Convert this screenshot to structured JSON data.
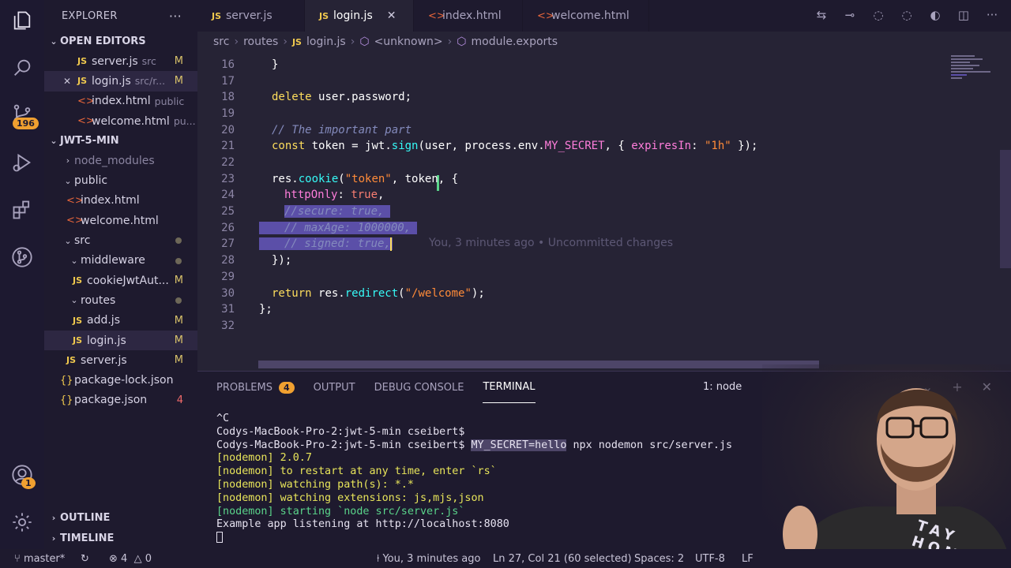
{
  "activity": {
    "source_control_badge": "196",
    "account_badge": "1"
  },
  "sidebar": {
    "title": "EXPLORER",
    "more": "···",
    "open_editors_title": "OPEN EDITORS",
    "open_editors": [
      {
        "icon": "JS",
        "name": "server.js",
        "desc": "src",
        "mark": "M"
      },
      {
        "icon": "JS",
        "name": "login.js",
        "desc": "src/r...",
        "mark": "M",
        "close": "✕"
      },
      {
        "icon": "<>",
        "name": "index.html",
        "desc": "public",
        "mark": ""
      },
      {
        "icon": "<>",
        "name": "welcome.html",
        "desc": "pu...",
        "mark": ""
      }
    ],
    "project_title": "JWT-5-MIN",
    "tree": [
      {
        "name": "node_modules",
        "type": "folder"
      },
      {
        "name": "public",
        "type": "folder"
      },
      {
        "name": "index.html",
        "type": "html"
      },
      {
        "name": "welcome.html",
        "type": "html"
      },
      {
        "name": "src",
        "type": "folder"
      },
      {
        "name": "middleware",
        "type": "folder"
      },
      {
        "name": "cookieJwtAut...",
        "type": "js",
        "mark": "M"
      },
      {
        "name": "routes",
        "type": "folder"
      },
      {
        "name": "add.js",
        "type": "js",
        "mark": "M"
      },
      {
        "name": "login.js",
        "type": "js",
        "mark": "M"
      },
      {
        "name": "server.js",
        "type": "js",
        "mark": "M"
      },
      {
        "name": "package-lock.json",
        "type": "json"
      },
      {
        "name": "package.json",
        "type": "json",
        "mark": "4"
      }
    ],
    "outline": "OUTLINE",
    "timeline": "TIMELINE"
  },
  "tabs": [
    {
      "icon": "JS",
      "label": "server.js"
    },
    {
      "icon": "JS",
      "label": "login.js",
      "close": "✕"
    },
    {
      "icon": "<>",
      "label": "index.html"
    },
    {
      "icon": "<>",
      "label": "welcome.html"
    }
  ],
  "breadcrumb": {
    "parts": [
      "src",
      "routes",
      "login.js",
      "<unknown>",
      "module.exports"
    ],
    "js_icon": "JS"
  },
  "editor": {
    "line_numbers": [
      "16",
      "17",
      "18",
      "19",
      "20",
      "21",
      "22",
      "23",
      "24",
      "25",
      "26",
      "27",
      "28",
      "29",
      "30",
      "31",
      "32"
    ],
    "lines": {
      "l16": "}",
      "l18_kw": "delete",
      "l18_rest": "user.password;",
      "l20": "// The important part",
      "l21_kw": "const",
      "l21_a": "token =",
      "l21_b": "jwt.",
      "l21_fn": "sign",
      "l21_c": "(user, process.env.",
      "l21_d": "MY_SECRET",
      "l21_e": ", {",
      "l21_f": "expiresIn",
      "l21_g": ":",
      "l21_str": "\"1h\"",
      "l21_h": "});",
      "l23_a": "res.",
      "l23_fn": "cookie",
      "l23_b": "(",
      "l23_str": "\"token\"",
      "l23_c": ", token, {",
      "l24_prop": "httpOnly",
      "l24_b": ":",
      "l24_bool": "true",
      "l24_c": ",",
      "l25": "//secure: true,",
      "l26": "// maxAge: 1000000,",
      "l27": "// signed: true,",
      "l27_blame": "You, 3 minutes ago • Uncommitted changes",
      "l28": "});",
      "l30_kw": "return",
      "l30_a": "res.",
      "l30_fn": "redirect",
      "l30_b": "(",
      "l30_str": "\"/welcome\"",
      "l30_c": ");",
      "l31": "};"
    }
  },
  "panel": {
    "problems": "PROBLEMS",
    "problems_count": "4",
    "output": "OUTPUT",
    "debug": "DEBUG CONSOLE",
    "terminal": "TERMINAL",
    "terminal_select": "1: node",
    "terminal_lines": {
      "t1": "^C",
      "t2": "Codys-MacBook-Pro-2:jwt-5-min cseibert$",
      "t3_prompt": "Codys-MacBook-Pro-2:jwt-5-min cseibert$ ",
      "t3_sel": "MY_SECRET=hello",
      "t3_rest": " npx nodemon src/server.js",
      "t4": "[nodemon] 2.0.7",
      "t5": "[nodemon] to restart at any time, enter `rs`",
      "t6": "[nodemon] watching path(s): *.*",
      "t7": "[nodemon] watching extensions: js,mjs,json",
      "t8": "[nodemon] starting `node src/server.js`",
      "t9": "Example app listening at http://localhost:8080"
    }
  },
  "statusbar": {
    "branch": "master*",
    "errors": "⊗ 4",
    "warnings": "△ 0",
    "blame": "You, 3 minutes ago",
    "position": "Ln 27, Col 21 (60 selected)",
    "spaces": "Spaces: 2",
    "encoding": "UTF-8",
    "eol": "LF"
  },
  "webcam": {
    "shirt_text": "TAY HOME"
  }
}
